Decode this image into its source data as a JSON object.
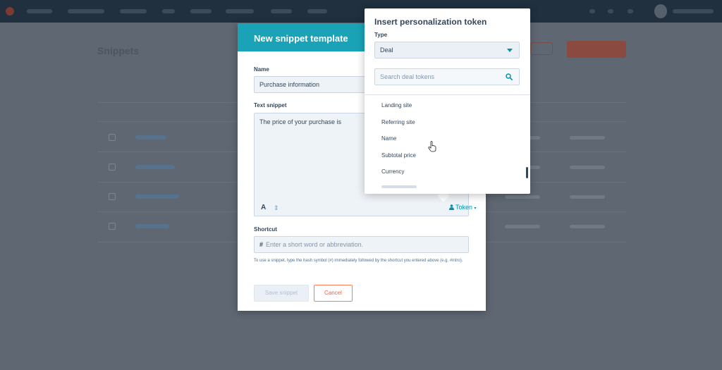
{
  "modal": {
    "title": "New snippet template",
    "name_label": "Name",
    "name_value": "Purchase information",
    "text_label": "Text snippet",
    "text_value": "The price of your purchase is",
    "format_icon_label": "A",
    "token_button_label": "Token",
    "shortcut_label": "Shortcut",
    "shortcut_placeholder": "Enter a short word or abbreviation.",
    "help_text": "To use a snippet, type the hash symbol (#) immediately followed by the shortcut you entered above (e.g. #intro).",
    "save_label": "Save snippet",
    "cancel_label": "Cancel"
  },
  "popover": {
    "title": "Insert personalization token",
    "type_label": "Type",
    "type_value": "Deal",
    "search_placeholder": "Search deal tokens",
    "items": [
      {
        "label": "Landing site"
      },
      {
        "label": "Referring site"
      },
      {
        "label": "Name"
      },
      {
        "label": "Subtotal price"
      },
      {
        "label": "Currency"
      }
    ]
  },
  "background": {
    "page_title": "Snippets"
  },
  "colors": {
    "header_teal": "#1aa3b6",
    "accent_link": "#0091ae",
    "cancel_orange": "#ff5c35",
    "overlay": "#5e6673"
  },
  "icons": [
    "chevron-down-icon",
    "search-icon",
    "token-person-icon",
    "resize-icon",
    "pointer-cursor-icon"
  ]
}
